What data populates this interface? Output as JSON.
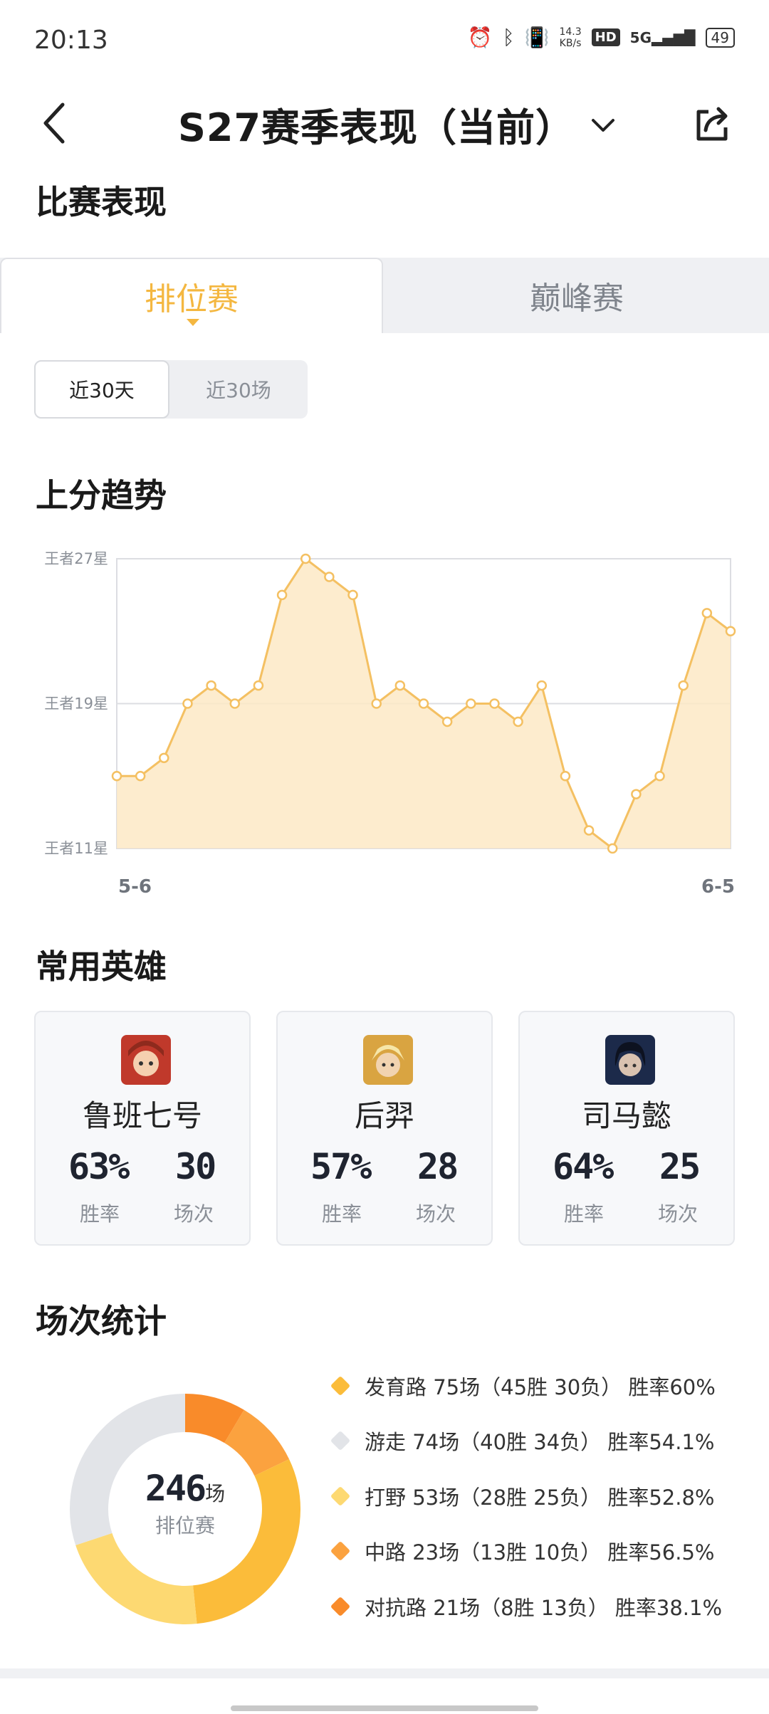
{
  "status_bar": {
    "time": "20:13",
    "net_speed_value": "14.3",
    "net_speed_unit": "KB/s",
    "hd": "HD",
    "signal": "5G",
    "battery": "49"
  },
  "header": {
    "title": "S27赛季表现（当前）"
  },
  "section_match": "比赛表现",
  "mode_tabs": [
    {
      "label": "排位赛",
      "active": true
    },
    {
      "label": "巅峰赛",
      "active": false
    }
  ],
  "range_toggle": [
    {
      "label": "近30天",
      "active": true
    },
    {
      "label": "近30场",
      "active": false
    }
  ],
  "section_trend": "上分趋势",
  "chart_data": {
    "type": "area",
    "y_tick_labels": [
      "王者27星",
      "王者19星",
      "王者11星"
    ],
    "ylim": [
      11,
      27
    ],
    "x_start_label": "5-6",
    "x_end_label": "6-5",
    "values": [
      15,
      15,
      16,
      19,
      20,
      19,
      20,
      25,
      27,
      26,
      25,
      19,
      20,
      19,
      18,
      19,
      19,
      18,
      20,
      15,
      12,
      11,
      14,
      15,
      20,
      24,
      23
    ],
    "grid": true,
    "colors": {
      "line": "#f4c062",
      "fill": "#fde9c6",
      "grid": "#dcdde2"
    }
  },
  "section_heroes": "常用英雄",
  "heroes": [
    {
      "name": "鲁班七号",
      "win_rate": "63%",
      "win_rate_label": "胜率",
      "games": "30",
      "games_label": "场次"
    },
    {
      "name": "后羿",
      "win_rate": "57%",
      "win_rate_label": "胜率",
      "games": "28",
      "games_label": "场次"
    },
    {
      "name": "司马懿",
      "win_rate": "64%",
      "win_rate_label": "胜率",
      "games": "25",
      "games_label": "场次"
    }
  ],
  "section_stats": "场次统计",
  "donut": {
    "total": "246",
    "unit": "场",
    "label": "排位赛",
    "segments": [
      {
        "text": "发育路 75场（45胜 30负） 胜率60%",
        "value": 75,
        "color": "#fbbc3a"
      },
      {
        "text": "游走 74场（40胜 34负） 胜率54.1%",
        "value": 74,
        "color": "#e2e4e8"
      },
      {
        "text": "打野 53场（28胜 25负） 胜率52.8%",
        "value": 53,
        "color": "#fdd972"
      },
      {
        "text": "中路 23场（13胜 10负） 胜率56.5%",
        "value": 23,
        "color": "#fba23f"
      },
      {
        "text": "对抗路 21场（8胜 13负） 胜率38.1%",
        "value": 21,
        "color": "#f98b2a"
      }
    ]
  }
}
